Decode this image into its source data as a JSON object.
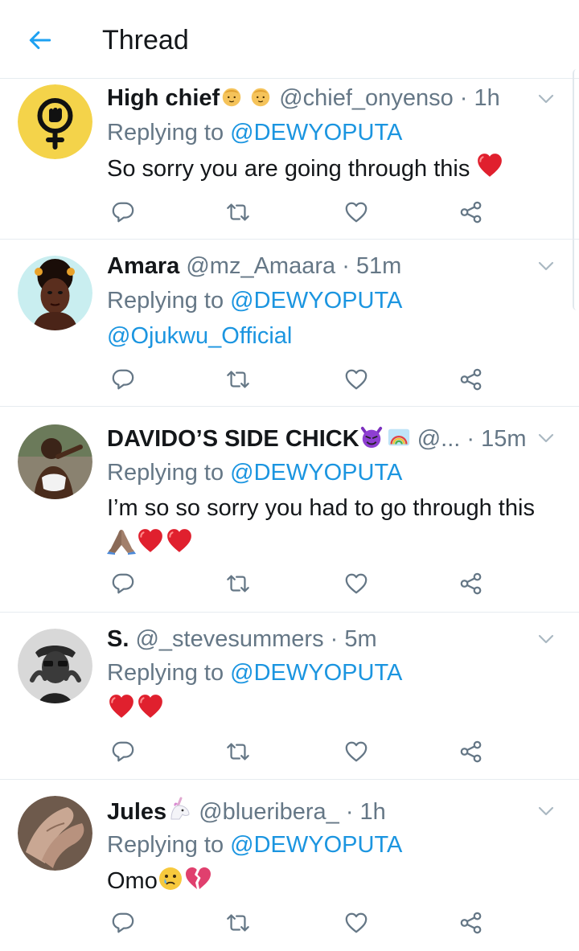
{
  "header": {
    "title": "Thread",
    "back_icon": "arrow-left-icon",
    "accent": "#1da1f2"
  },
  "colors": {
    "link": "#1b95e0",
    "secondary": "#657786",
    "primary": "#14171a",
    "divider": "#e6ecf0"
  },
  "tweets": [
    {
      "name": "High chief",
      "handle": "@chief_onyenso",
      "time": "· 1h",
      "replying_prefix": "Replying to",
      "replying_to": "@DEWYOPUTA",
      "text": "So sorry you are going through this"
    },
    {
      "name": "Amara",
      "handle": "@mz_Amaara",
      "time": "· 51m",
      "replying_prefix": "Replying to",
      "replying_to": "@DEWYOPUTA",
      "text": "@Ojukwu_Official"
    },
    {
      "name": "DAVIDO’S SIDE CHICK",
      "handle": "@...",
      "time": "· 15m",
      "replying_prefix": "Replying to",
      "replying_to": "@DEWYOPUTA",
      "text": "I’m so so sorry you had to go through this"
    },
    {
      "name": "S.",
      "handle": "@_stevesummers",
      "time": "· 5m",
      "replying_prefix": "Replying to",
      "replying_to": "@DEWYOPUTA",
      "text": ""
    },
    {
      "name": "Jules",
      "handle": "@blueribera_",
      "time": "· 1h",
      "replying_prefix": "Replying to",
      "replying_to": "@DEWYOPUTA",
      "text": "Omo"
    }
  ],
  "action_icons": [
    "reply-icon",
    "retweet-icon",
    "like-icon",
    "share-icon"
  ]
}
